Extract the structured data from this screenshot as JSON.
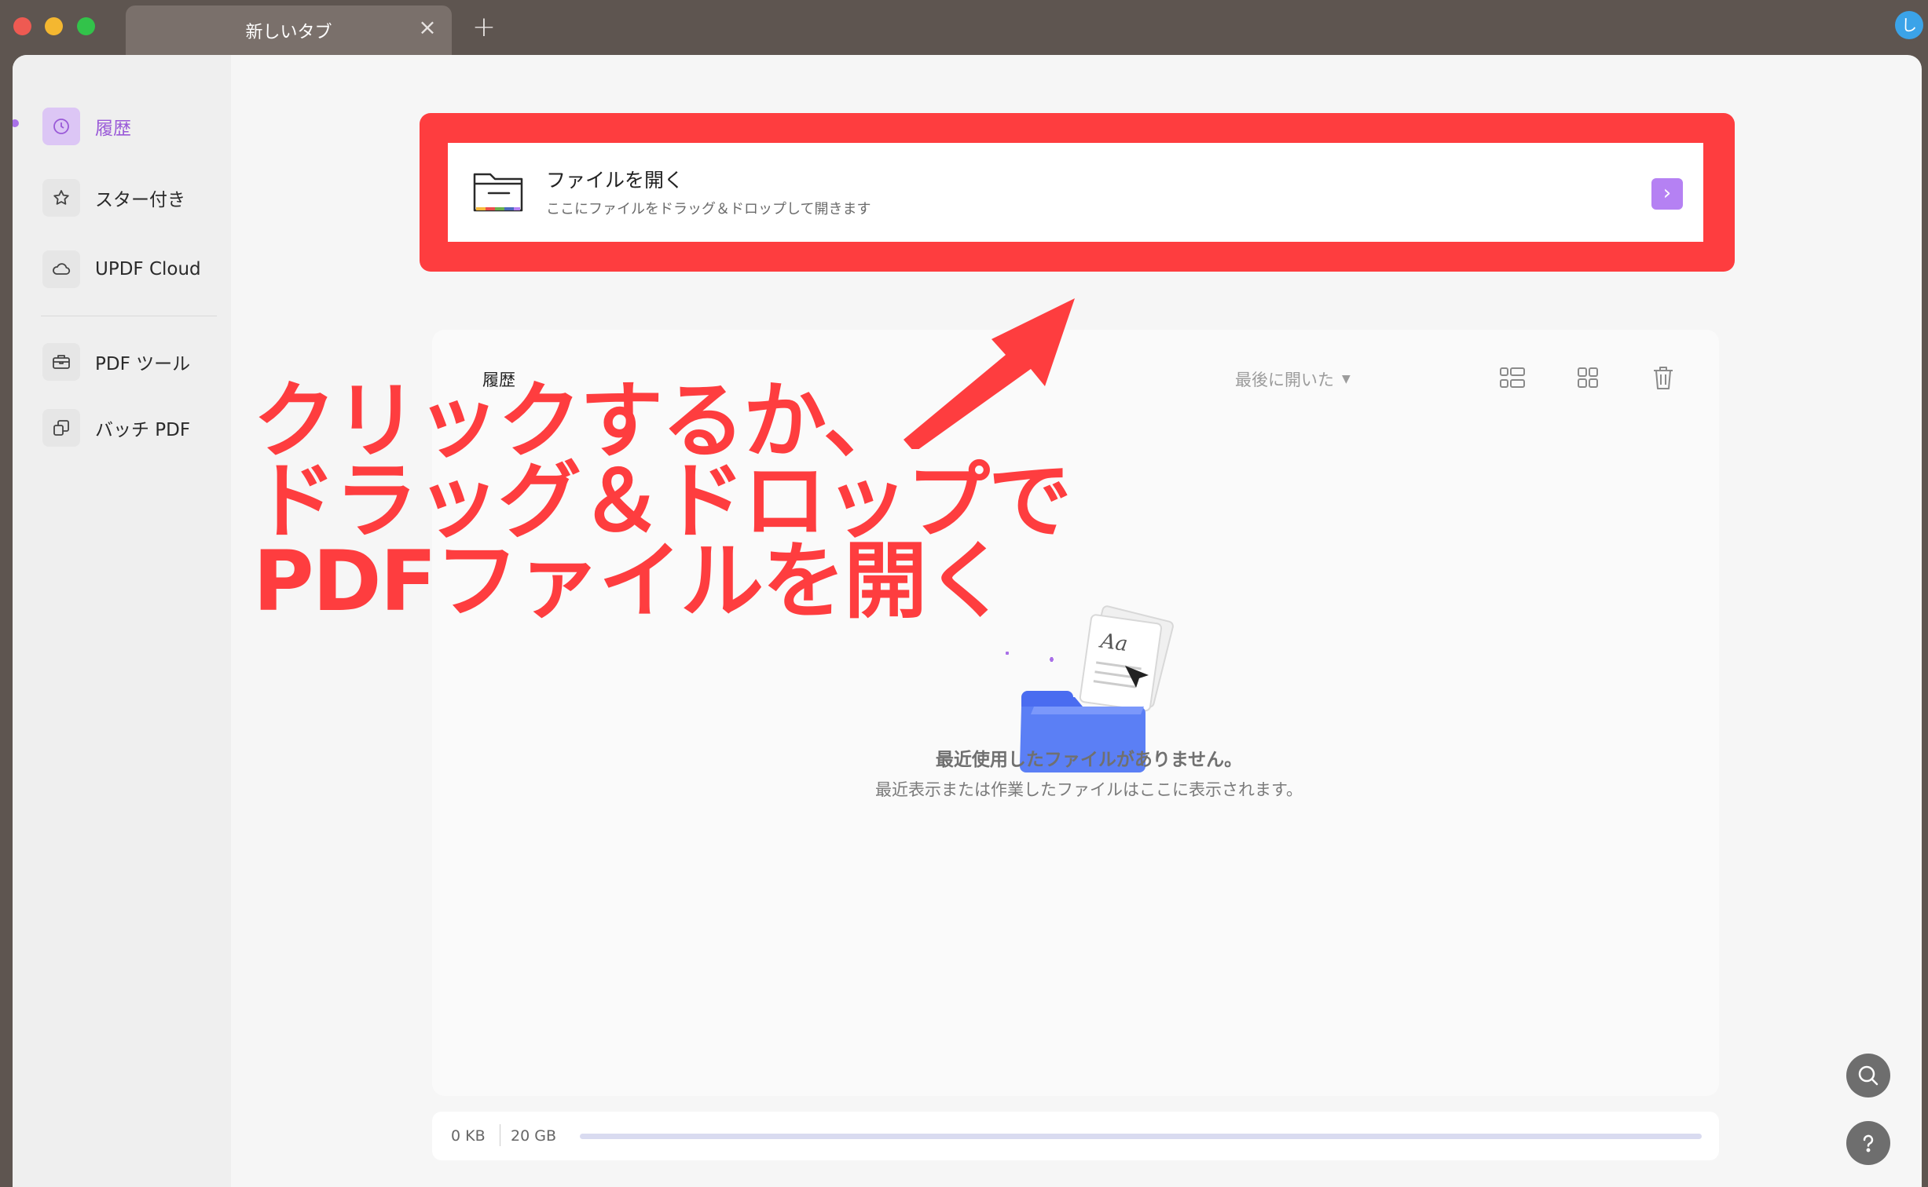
{
  "titlebar": {
    "tab_title": "新しいタブ",
    "tab_close_icon": "×",
    "tab_add_icon": "+",
    "user_initial": "し"
  },
  "sidebar": {
    "items": [
      {
        "label": "履歴",
        "icon": "clock-icon",
        "active": true
      },
      {
        "label": "スター付き",
        "icon": "star-icon",
        "active": false
      },
      {
        "label": "UPDF Cloud",
        "icon": "cloud-icon",
        "active": false
      },
      {
        "label": "PDF ツール",
        "icon": "toolbox-icon",
        "active": false
      },
      {
        "label": "バッチ PDF",
        "icon": "batch-icon",
        "active": false
      }
    ]
  },
  "open_file": {
    "title": "ファイルを開く",
    "subtitle": "ここにファイルをドラッグ＆ドロップして開きます",
    "go_icon": "›"
  },
  "history": {
    "title": "履歴",
    "sort_label": "最後に開いた",
    "sort_caret": "▼",
    "empty_title": "最近使用したファイルがありません。",
    "empty_desc": "最近表示または作業したファイルはここに表示されます。"
  },
  "storage": {
    "used": "0 KB",
    "total": "20 GB",
    "used_fraction": 0
  },
  "annotation": {
    "line1": "クリックするか、",
    "line2": "ドラッグ＆ドロップで",
    "line3": "PDFファイルを開く"
  },
  "colors": {
    "accent": "#b581f3",
    "highlight": "#fe3d3f"
  }
}
